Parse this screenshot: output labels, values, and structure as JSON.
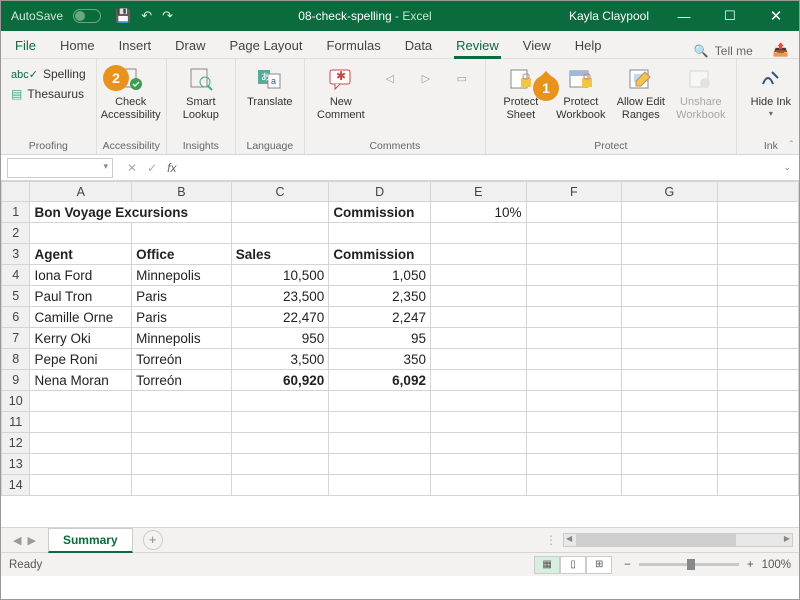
{
  "titlebar": {
    "autosave": "AutoSave",
    "filename": "08-check-spelling",
    "app": "Excel",
    "user": "Kayla Claypool"
  },
  "tabs": [
    "File",
    "Home",
    "Insert",
    "Draw",
    "Page Layout",
    "Formulas",
    "Data",
    "Review",
    "View",
    "Help"
  ],
  "active_tab": "Review",
  "tellme": "Tell me",
  "ribbon": {
    "proofing": {
      "label": "Proofing",
      "spelling": "Spelling",
      "thesaurus": "Thesaurus"
    },
    "accessibility": {
      "label": "Accessibility",
      "btn": "Check Accessibility"
    },
    "insights": {
      "label": "Insights",
      "btn": "Smart Lookup"
    },
    "language": {
      "label": "Language",
      "btn": "Translate"
    },
    "comments": {
      "label": "Comments",
      "btn": "New Comment"
    },
    "protect": {
      "label": "Protect",
      "sheet": "Protect Sheet",
      "workbook": "Protect Workbook",
      "ranges": "Allow Edit Ranges",
      "unshare": "Unshare Workbook"
    },
    "ink": {
      "label": "Ink",
      "btn": "Hide Ink"
    }
  },
  "callouts": {
    "one": "1",
    "two": "2"
  },
  "namebox": "",
  "columns": [
    "A",
    "B",
    "C",
    "D",
    "E",
    "F",
    "G"
  ],
  "sheet": {
    "title": "Bon Voyage Excursions",
    "d1": "Commission",
    "e1": "10%",
    "headers": {
      "a": "Agent",
      "b": "Office",
      "c": "Sales",
      "d": "Commission"
    },
    "rows": [
      {
        "a": "Iona Ford",
        "b": "Minnepolis",
        "c": "10,500",
        "d": "1,050"
      },
      {
        "a": "Paul Tron",
        "b": "Paris",
        "c": "23,500",
        "d": "2,350"
      },
      {
        "a": "Camille Orne",
        "b": "Paris",
        "c": "22,470",
        "d": "2,247"
      },
      {
        "a": "Kerry Oki",
        "b": "Minnepolis",
        "c": "950",
        "d": "95"
      },
      {
        "a": "Pepe Roni",
        "b": "Torreón",
        "c": "3,500",
        "d": "350"
      },
      {
        "a": "Nena Moran",
        "b": "Torreón",
        "c": "60,920",
        "d": "6,092"
      }
    ]
  },
  "sheet_tab": "Summary",
  "status": {
    "ready": "Ready",
    "zoom": "100%"
  }
}
